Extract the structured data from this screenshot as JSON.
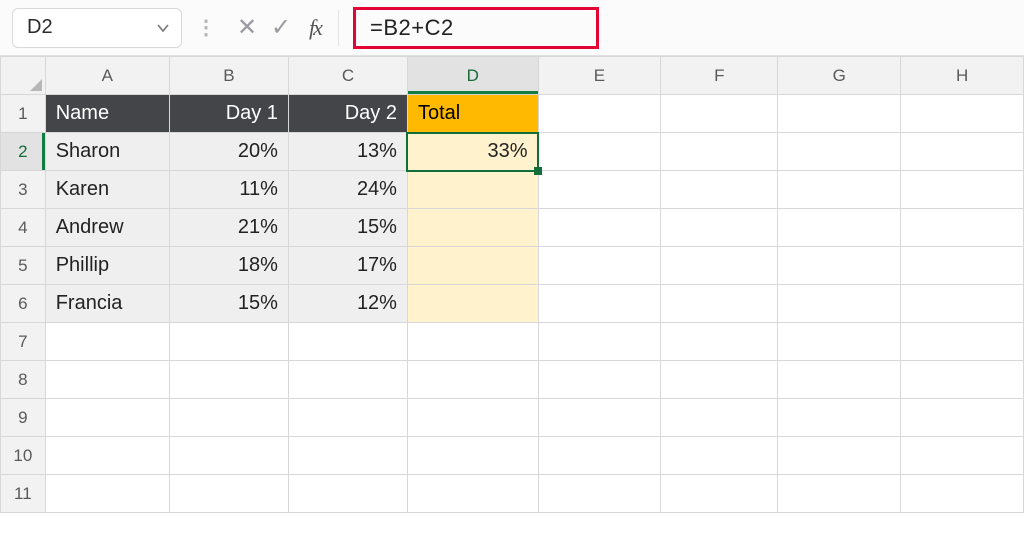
{
  "formulaBar": {
    "nameBox": "D2",
    "cancelGlyph": "✕",
    "enterGlyph": "✓",
    "fxLabel": "fx",
    "formula": "=B2+C2",
    "sepGlyph": "⋮"
  },
  "columns": [
    "A",
    "B",
    "C",
    "D",
    "E",
    "F",
    "G",
    "H"
  ],
  "rowCount": 11,
  "selectedCell": {
    "col": "D",
    "row": 2
  },
  "headerRow": {
    "A": "Name",
    "B": "Day 1",
    "C": "Day 2",
    "D": "Total"
  },
  "dataRows": [
    {
      "A": "Sharon",
      "B": "20%",
      "C": "13%",
      "D": "33%"
    },
    {
      "A": "Karen",
      "B": "11%",
      "C": "24%",
      "D": ""
    },
    {
      "A": "Andrew",
      "B": "21%",
      "C": "15%",
      "D": ""
    },
    {
      "A": "Phillip",
      "B": "18%",
      "C": "17%",
      "D": ""
    },
    {
      "A": "Francia",
      "B": "15%",
      "C": "12%",
      "D": ""
    }
  ],
  "chart_data": {
    "type": "table",
    "title": "",
    "columns": [
      "Name",
      "Day 1",
      "Day 2",
      "Total"
    ],
    "rows": [
      [
        "Sharon",
        "20%",
        "13%",
        "33%"
      ],
      [
        "Karen",
        "11%",
        "24%",
        ""
      ],
      [
        "Andrew",
        "21%",
        "15%",
        ""
      ],
      [
        "Phillip",
        "18%",
        "17%",
        ""
      ],
      [
        "Francia",
        "15%",
        "12%",
        ""
      ]
    ],
    "active_formula": "=B2+C2",
    "active_cell": "D2"
  }
}
